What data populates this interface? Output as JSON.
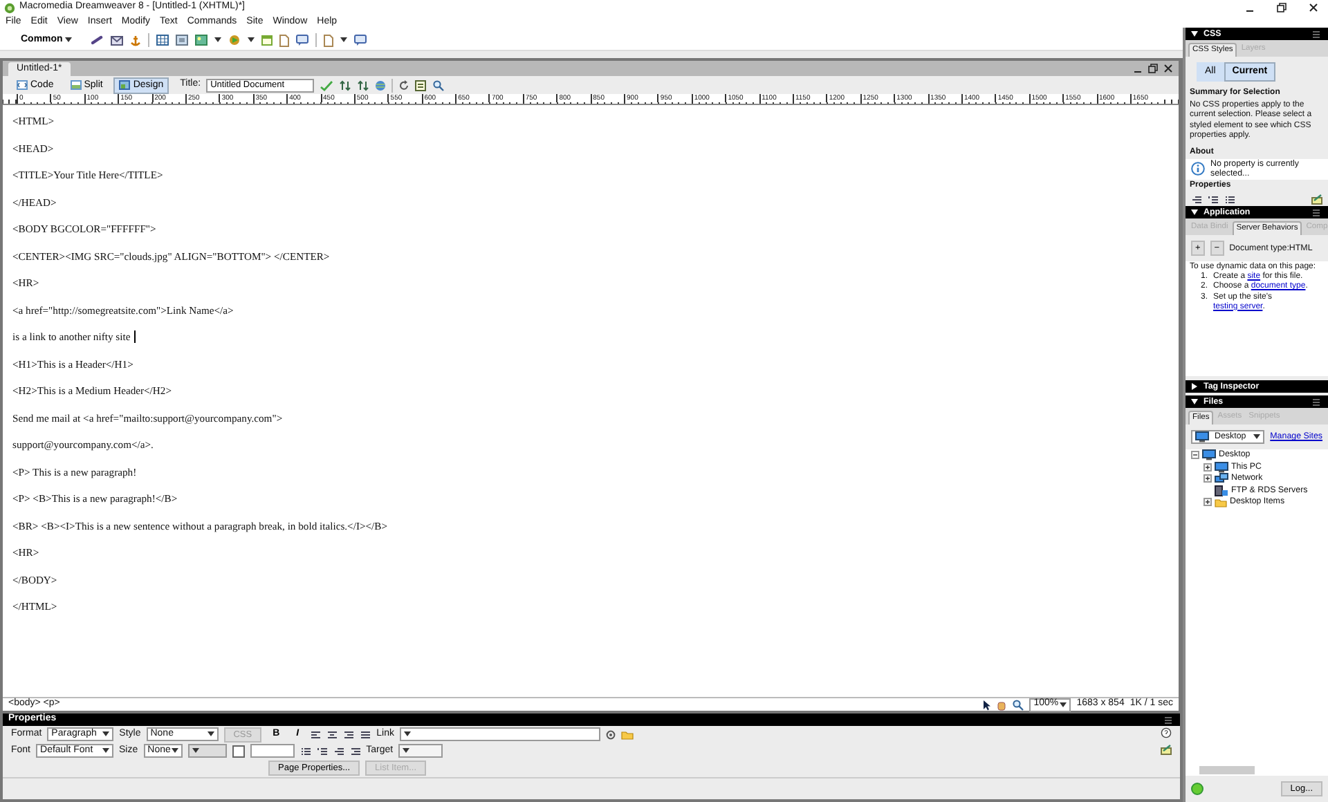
{
  "window": {
    "title": "Macromedia Dreamweaver 8 - [Untitled-1 (XHTML)*]"
  },
  "menu": [
    "File",
    "Edit",
    "View",
    "Insert",
    "Modify",
    "Text",
    "Commands",
    "Site",
    "Window",
    "Help"
  ],
  "insert_bar": {
    "category": "Common"
  },
  "document": {
    "tab": "Untitled-1*",
    "views": [
      {
        "label": "Code",
        "selected": false
      },
      {
        "label": "Split",
        "selected": false
      },
      {
        "label": "Design",
        "selected": true
      }
    ],
    "title_label": "Title:",
    "title_value": "Untitled Document",
    "ruler": [
      "0",
      "50",
      "100",
      "150",
      "200",
      "250",
      "300",
      "350",
      "400",
      "450",
      "500",
      "550",
      "600",
      "650",
      "700",
      "750",
      "800",
      "850",
      "900",
      "950",
      "1000",
      "1050",
      "1100",
      "1150",
      "1200",
      "1250",
      "1300",
      "1350",
      "1400",
      "1450",
      "1500",
      "1550",
      "1600",
      "1650"
    ],
    "lines": [
      {
        "text": "<HTML>",
        "cursor": false
      },
      {
        "text": "<HEAD>",
        "cursor": false
      },
      {
        "text": "<TITLE>Your Title Here</TITLE>",
        "cursor": false
      },
      {
        "text": "</HEAD>",
        "cursor": false
      },
      {
        "text": "<BODY BGCOLOR=\"FFFFFF\">",
        "cursor": false
      },
      {
        "text": "<CENTER><IMG SRC=\"clouds.jpg\" ALIGN=\"BOTTOM\"> </CENTER>",
        "cursor": false
      },
      {
        "text": "<HR>",
        "cursor": false
      },
      {
        "text": "<a href=\"http://somegreatsite.com\">Link Name</a>",
        "cursor": false
      },
      {
        "text": "is a link to another nifty site",
        "cursor": true
      },
      {
        "text": "<H1>This is a Header</H1>",
        "cursor": false
      },
      {
        "text": "<H2>This is a Medium Header</H2>",
        "cursor": false
      },
      {
        "text": "Send me mail at <a href=\"mailto:support@yourcompany.com\">",
        "cursor": false
      },
      {
        "text": "support@yourcompany.com</a>.",
        "cursor": false
      },
      {
        "text": "<P> This is a new paragraph!",
        "cursor": false
      },
      {
        "text": "<P> <B>This is a new paragraph!</B>",
        "cursor": false
      },
      {
        "text": "<BR> <B><I>This is a new sentence without a paragraph break, in bold italics.</I></B>",
        "cursor": false
      },
      {
        "text": "<HR>",
        "cursor": false
      },
      {
        "text": "</BODY>",
        "cursor": false
      },
      {
        "text": "</HTML>",
        "cursor": false
      }
    ],
    "status": {
      "tags": "<body> <p>",
      "zoom": "100%",
      "size": "1683 x 854",
      "download": "1K / 1 sec"
    }
  },
  "properties": {
    "title": "Properties",
    "format_label": "Format",
    "format": "Paragraph",
    "style_label": "Style",
    "style": "None",
    "css": "CSS",
    "bold": "B",
    "italic": "I",
    "link_label": "Link",
    "font_label": "Font",
    "font": "Default Font",
    "size_label": "Size",
    "size": "None",
    "target_label": "Target",
    "buttons": [
      {
        "label": "Page Properties...",
        "disabled": false
      },
      {
        "label": "List Item...",
        "disabled": true
      }
    ]
  },
  "panels": {
    "css": {
      "title": "CSS",
      "expanded": true,
      "tabs": [
        {
          "label": "CSS Styles",
          "selected": true
        },
        {
          "label": "Layers",
          "selected": false
        }
      ],
      "modes": [
        {
          "label": "All",
          "selected": false
        },
        {
          "label": "Current",
          "selected": true
        }
      ],
      "summary_title": "Summary for Selection",
      "summary": "No CSS properties apply to the current selection.  Please select a styled element to see which CSS properties apply.",
      "about_title": "About",
      "about": "No property is currently selected...",
      "properties_title": "Properties"
    },
    "application": {
      "title": "Application",
      "expanded": true,
      "tabs": [
        {
          "label": "Data Bindi",
          "selected": false
        },
        {
          "label": "Server Behaviors",
          "selected": true
        },
        {
          "label": "Comp",
          "selected": false
        }
      ],
      "buttons": [
        "+",
        "−"
      ],
      "doctype": "Document type:HTML",
      "intro": "To use dynamic data on this page:",
      "steps": [
        {
          "marker": "1.",
          "parts": [
            "Create a ",
            "site",
            " for this file."
          ]
        },
        {
          "marker": "2.",
          "parts": [
            "Choose a ",
            "document type",
            "."
          ]
        },
        {
          "marker": "3.",
          "parts": [
            "Set up the site's ",
            "testing server",
            "."
          ]
        }
      ]
    },
    "tag_inspector": {
      "title": "Tag Inspector",
      "expanded": false
    },
    "files": {
      "title": "Files",
      "expanded": true,
      "tabs": [
        {
          "label": "Files",
          "selected": true
        },
        {
          "label": "Assets",
          "selected": false
        },
        {
          "label": "Snippets",
          "selected": false
        }
      ],
      "site": "Desktop",
      "manage": "Manage Sites",
      "tree": [
        {
          "label": "Desktop",
          "expandable": true,
          "expanded": true,
          "children": [
            {
              "label": "This PC",
              "expandable": true,
              "expanded": false
            },
            {
              "label": "Network",
              "expandable": true,
              "expanded": false
            },
            {
              "label": "FTP & RDS Servers",
              "expandable": false
            },
            {
              "label": "Desktop Items",
              "expandable": true,
              "expanded": false
            }
          ]
        }
      ],
      "log": "Log..."
    }
  }
}
